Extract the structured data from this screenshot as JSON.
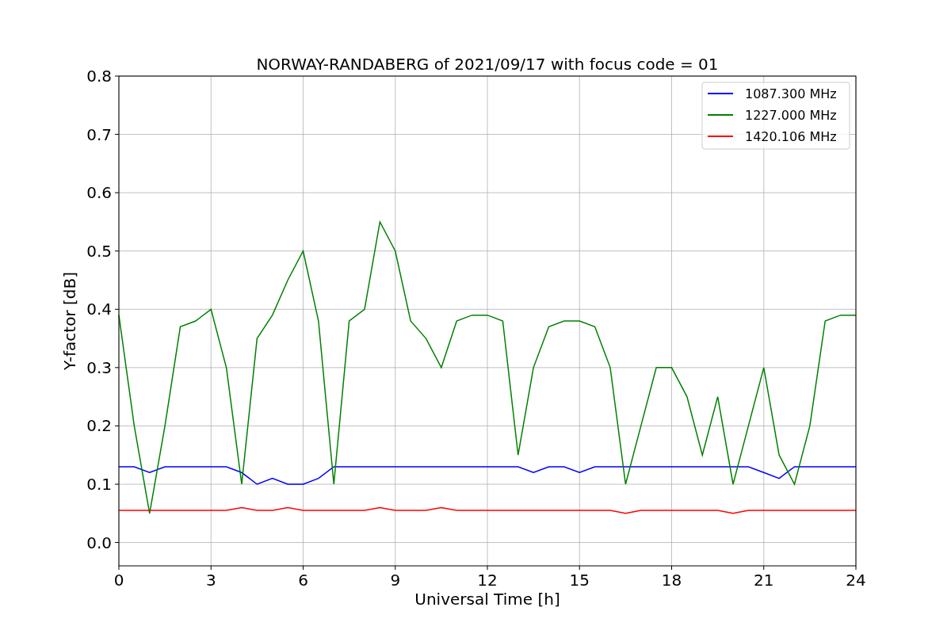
{
  "figure": {
    "chart_data": {
      "type": "line",
      "title": "NORWAY-RANDABERG of 2021/09/17 with focus code = 01",
      "xlabel": "Universal Time [h]",
      "ylabel": "Y-factor [dB]",
      "x": [
        0,
        0.5,
        1,
        1.5,
        2,
        2.5,
        3,
        3.5,
        4,
        4.5,
        5,
        5.5,
        6,
        6.5,
        7,
        7.5,
        8,
        8.5,
        9,
        9.5,
        10,
        10.5,
        11,
        11.5,
        12,
        12.5,
        13,
        13.5,
        14,
        14.5,
        15,
        15.5,
        16,
        16.5,
        17,
        17.5,
        18,
        18.5,
        19,
        19.5,
        20,
        20.5,
        21,
        21.5,
        22,
        22.5,
        23,
        23.5,
        24
      ],
      "series": [
        {
          "name": "1087.300 MHz",
          "color": "#0000ff",
          "values": [
            0.13,
            0.13,
            0.12,
            0.13,
            0.13,
            0.13,
            0.13,
            0.13,
            0.12,
            0.1,
            0.11,
            0.1,
            0.1,
            0.11,
            0.13,
            0.13,
            0.13,
            0.13,
            0.13,
            0.13,
            0.13,
            0.13,
            0.13,
            0.13,
            0.13,
            0.13,
            0.13,
            0.12,
            0.13,
            0.13,
            0.12,
            0.13,
            0.13,
            0.13,
            0.13,
            0.13,
            0.13,
            0.13,
            0.13,
            0.13,
            0.13,
            0.13,
            0.12,
            0.11,
            0.13,
            0.13,
            0.13,
            0.13,
            0.13
          ]
        },
        {
          "name": "1227.000 MHz",
          "color": "#008000",
          "values": [
            0.39,
            0.2,
            0.05,
            0.2,
            0.37,
            0.38,
            0.4,
            0.3,
            0.1,
            0.35,
            0.39,
            0.45,
            0.5,
            0.38,
            0.1,
            0.38,
            0.4,
            0.55,
            0.5,
            0.38,
            0.35,
            0.3,
            0.38,
            0.39,
            0.39,
            0.38,
            0.15,
            0.3,
            0.37,
            0.38,
            0.38,
            0.37,
            0.3,
            0.1,
            0.2,
            0.3,
            0.3,
            0.25,
            0.15,
            0.25,
            0.1,
            0.2,
            0.3,
            0.15,
            0.1,
            0.2,
            0.38,
            0.39,
            0.39
          ]
        },
        {
          "name": "1420.106 MHz",
          "color": "#ff0000",
          "values": [
            0.055,
            0.055,
            0.055,
            0.055,
            0.055,
            0.055,
            0.055,
            0.055,
            0.06,
            0.055,
            0.055,
            0.06,
            0.055,
            0.055,
            0.055,
            0.055,
            0.055,
            0.06,
            0.055,
            0.055,
            0.055,
            0.06,
            0.055,
            0.055,
            0.055,
            0.055,
            0.055,
            0.055,
            0.055,
            0.055,
            0.055,
            0.055,
            0.055,
            0.05,
            0.055,
            0.055,
            0.055,
            0.055,
            0.055,
            0.055,
            0.05,
            0.055,
            0.055,
            0.055,
            0.055,
            0.055,
            0.055,
            0.055,
            0.055
          ]
        }
      ],
      "xlim": [
        0,
        24
      ],
      "ylim": [
        -0.04,
        0.8
      ],
      "grid": true,
      "legend": true,
      "xticks": [
        0,
        3,
        6,
        9,
        12,
        15,
        18,
        21,
        24
      ],
      "yticks": [
        {
          "value": 0,
          "label": "0.0"
        },
        {
          "value": 0.1,
          "label": "0.1"
        },
        {
          "value": 0.2,
          "label": "0.2"
        },
        {
          "value": 0.3,
          "label": "0.3"
        },
        {
          "value": 0.4,
          "label": "0.4"
        },
        {
          "value": 0.5,
          "label": "0.5"
        },
        {
          "value": 0.6,
          "label": "0.6"
        },
        {
          "value": 0.7,
          "label": "0.7"
        },
        {
          "value": 0.8,
          "label": "0.8"
        }
      ]
    }
  }
}
